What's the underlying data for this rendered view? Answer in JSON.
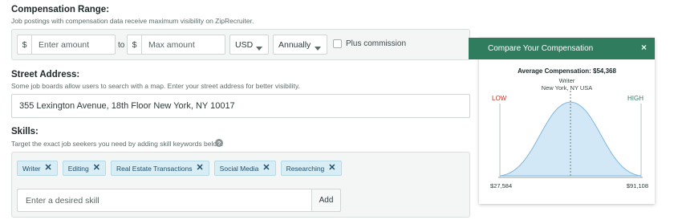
{
  "compensation": {
    "title": "Compensation Range:",
    "help": "Job postings with compensation data receive maximum visibility on ZipRecruiter.",
    "currency_symbol": "$",
    "min_placeholder": "Enter amount",
    "to_label": "to",
    "max_placeholder": "Max amount",
    "currency": "USD",
    "period": "Annually",
    "plus_commission_label": "Plus commission",
    "plus_commission_checked": false
  },
  "street": {
    "title": "Street Address:",
    "help": "Some job boards allow users to search with a map. Enter your street address for better visibility.",
    "value": "355 Lexington Avenue, 18th Floor New York, NY 10017"
  },
  "skills": {
    "title": "Skills:",
    "help": "Target the exact job seekers you need by adding skill keywords below.",
    "help_icon": "?",
    "tags": [
      "Writer",
      "Editing",
      "Real Estate Transactions",
      "Social Media",
      "Researching"
    ],
    "remove_icon": "✕",
    "input_placeholder": "Enter a desired skill",
    "add_label": "Add"
  },
  "compare": {
    "header": "Compare Your Compensation",
    "close_icon": "×",
    "average": "Average Compensation: $54,368",
    "job_title": "Writer",
    "location": "New York, NY USA",
    "low_label": "LOW",
    "high_label": "HIGH",
    "min_value": "$27,584",
    "max_value": "$91,108",
    "colors": {
      "header": "#2f7c5f",
      "low": "#c0392b",
      "high": "#2f7c5f",
      "curve_fill": "#d3e8f6",
      "curve_stroke": "#7fb7de"
    }
  }
}
